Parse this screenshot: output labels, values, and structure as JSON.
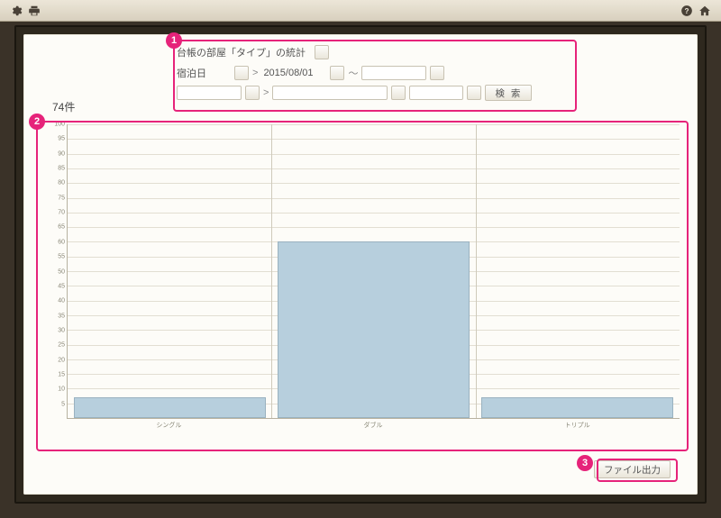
{
  "topbar": {},
  "filter": {
    "title": "台帳の部屋「タイプ」の統計",
    "field1_label": "宿泊日",
    "date_from": "2015/08/01",
    "tilde": "～",
    "gt": ">",
    "search_label": "検  索"
  },
  "result_count": "74件",
  "export_label": "ファイル出力",
  "annotations": {
    "a1": "1",
    "a2": "2",
    "a3": "3"
  },
  "chart_data": {
    "type": "bar",
    "categories": [
      "シングル",
      "ダブル",
      "トリプル"
    ],
    "values": [
      7,
      60,
      7
    ],
    "title": "",
    "xlabel": "",
    "ylabel": "",
    "ylim": [
      0,
      100
    ],
    "yticks": [
      5,
      10,
      15,
      20,
      25,
      30,
      35,
      40,
      45,
      50,
      55,
      60,
      65,
      70,
      75,
      80,
      85,
      90,
      95,
      100
    ]
  }
}
